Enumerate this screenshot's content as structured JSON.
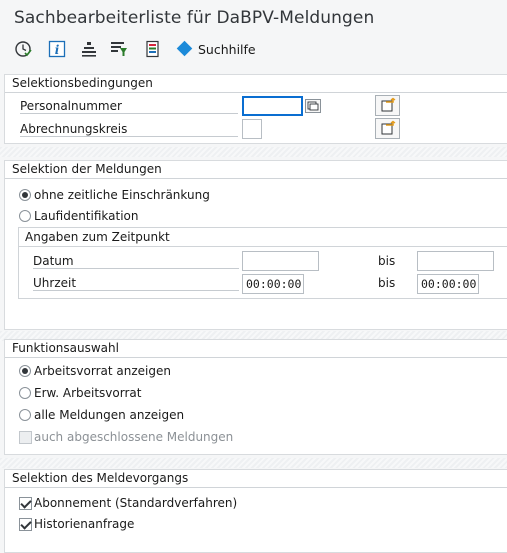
{
  "window": {
    "title": "Sachbearbeiterliste für DaBPV-Meldungen"
  },
  "toolbar": {
    "icons": [
      "execute-icon",
      "info-icon",
      "get-variant-icon",
      "save-variant-icon",
      "layout-icon"
    ],
    "suchhilfe_label": "Suchhilfe"
  },
  "selektionsbedingungen": {
    "title": "Selektionsbedingungen",
    "personalnummer": {
      "label": "Personalnummer",
      "value": ""
    },
    "abrechnungskreis": {
      "label": "Abrechnungskreis",
      "value": ""
    }
  },
  "meldungen": {
    "title": "Selektion der Meldungen",
    "opt_ohne": "ohne zeitliche Einschränkung",
    "opt_lauf": "Laufidentifikation",
    "selected": "ohne",
    "zeitpunkt": {
      "title": "Angaben zum Zeitpunkt",
      "datum_label": "Datum",
      "datum_from": "",
      "datum_to": "",
      "uhrzeit_label": "Uhrzeit",
      "uhrzeit_from": "00:00:00",
      "uhrzeit_to": "00:00:00",
      "bis_label": "bis"
    }
  },
  "funktionsauswahl": {
    "title": "Funktionsauswahl",
    "opt_arbeitsvorrat": "Arbeitsvorrat anzeigen",
    "opt_erw": "Erw. Arbeitsvorrat",
    "opt_alle": "alle Meldungen anzeigen",
    "chk_abgeschlossen": "auch abgeschlossene Meldungen",
    "selected": "arbeitsvorrat",
    "abgeschlossen_checked": false
  },
  "meldevorgang": {
    "title": "Selektion des Meldevorgangs",
    "chk_abonnement": "Abonnement (Standardverfahren)",
    "chk_historie": "Historienanfrage",
    "abonnement_checked": true,
    "historie_checked": true
  },
  "colors": {
    "accent": "#0a6ed1",
    "diamond": "#1c8ad9",
    "background": "#f5f6f7"
  }
}
